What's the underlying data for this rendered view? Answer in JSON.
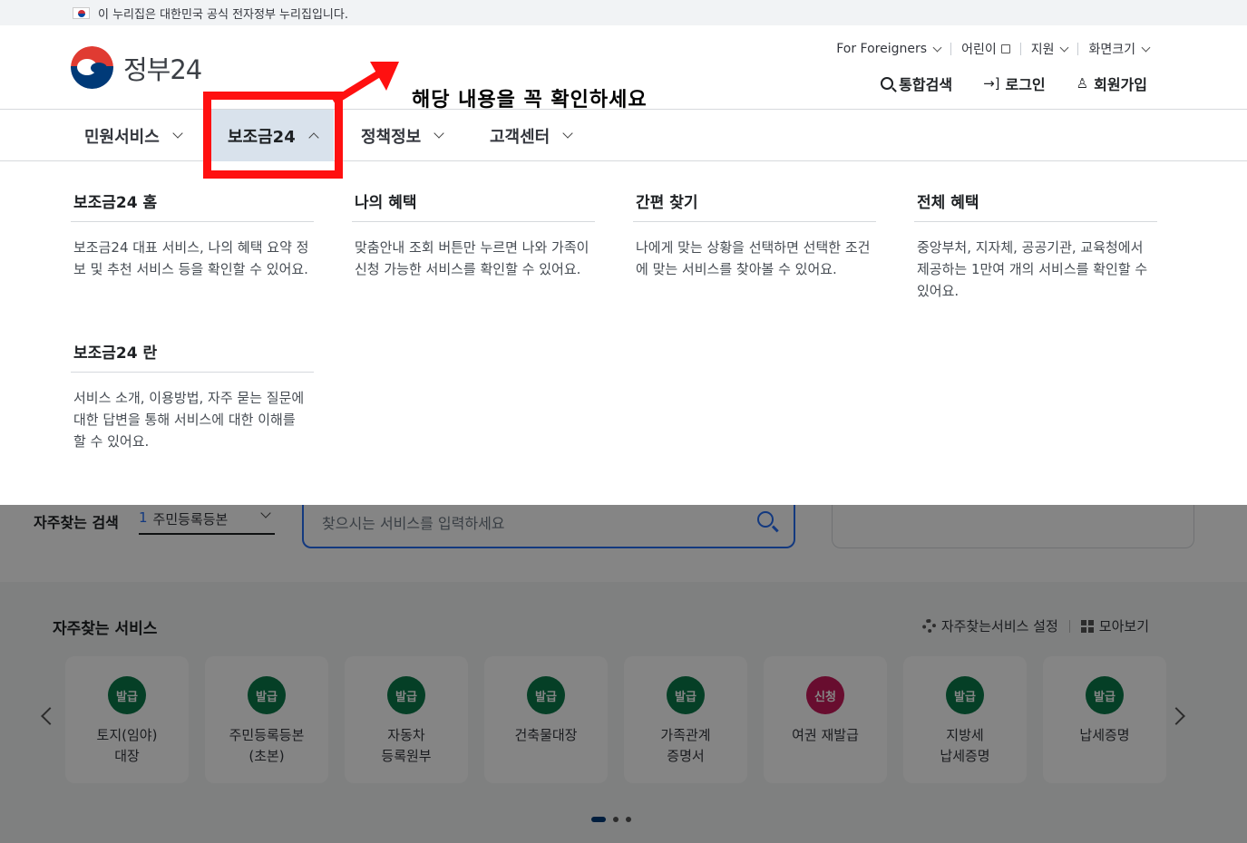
{
  "banner": {
    "text": "이 누리집은 대한민국 공식 전자정부 누리집입니다."
  },
  "logo": {
    "text": "정부24"
  },
  "util": {
    "foreigners": "For Foreigners",
    "kids": "어린이",
    "support": "지원",
    "font_size": "화면크기"
  },
  "actions": {
    "search": "통합검색",
    "login": "로그인",
    "signup": "회원가입"
  },
  "annotation": {
    "text": "해당 내용을 꼭 확인하세요",
    "color": "#ff1010"
  },
  "nav": {
    "items": [
      {
        "label": "민원서비스"
      },
      {
        "label": "보조금24"
      },
      {
        "label": "정책정보"
      },
      {
        "label": "고객센터"
      }
    ],
    "active_bg": "#d9e2ec"
  },
  "mega": {
    "columns": [
      {
        "title": "보조금24 홈",
        "desc": "보조금24 대표 서비스, 나의 혜택 요약 정보 및 추천 서비스 등을 확인할 수 있어요."
      },
      {
        "title": "나의 혜택",
        "desc": "맞춤안내 조회 버튼만 누르면 나와 가족이 신청 가능한 서비스를 확인할 수 있어요."
      },
      {
        "title": "간편 찾기",
        "desc": "나에게 맞는 상황을 선택하면 선택한 조건에 맞는 서비스를 찾아볼 수 있어요."
      },
      {
        "title": "전체 혜택",
        "desc": "중앙부처, 지자체, 공공기관, 교육청에서 제공하는 1만여 개의 서비스를 확인할 수 있어요."
      },
      {
        "title": "보조금24 란",
        "desc": "서비스 소개, 이용방법, 자주 묻는 질문에 대한 답변을 통해 서비스에 대한 이해를 할 수 있어요."
      }
    ]
  },
  "frequent_search": {
    "label": "자주찾는 검색",
    "selected_num": "1",
    "selected_text": "주민등록등본",
    "placeholder": "찾으시는 서비스를 입력하세요"
  },
  "favorites": {
    "title": "자주찾는 서비스",
    "settings": "자주찾는서비스 설정",
    "view_all": "모아보기",
    "cards": [
      {
        "badge": "발급",
        "label": "토지(임야)\n대장",
        "badge_color": "#0a7a4a"
      },
      {
        "badge": "발급",
        "label": "주민등록등본\n(초본)",
        "badge_color": "#0a7a4a"
      },
      {
        "badge": "발급",
        "label": "자동차\n등록원부",
        "badge_color": "#0a7a4a"
      },
      {
        "badge": "발급",
        "label": "건축물대장",
        "badge_color": "#0a7a4a"
      },
      {
        "badge": "발급",
        "label": "가족관계\n증명서",
        "badge_color": "#0a7a4a"
      },
      {
        "badge": "신청",
        "label": "여권 재발급",
        "badge_color": "#c8195a"
      },
      {
        "badge": "발급",
        "label": "지방세\n납세증명",
        "badge_color": "#0a7a4a"
      },
      {
        "badge": "발급",
        "label": "납세증명",
        "badge_color": "#0a7a4a"
      }
    ]
  }
}
